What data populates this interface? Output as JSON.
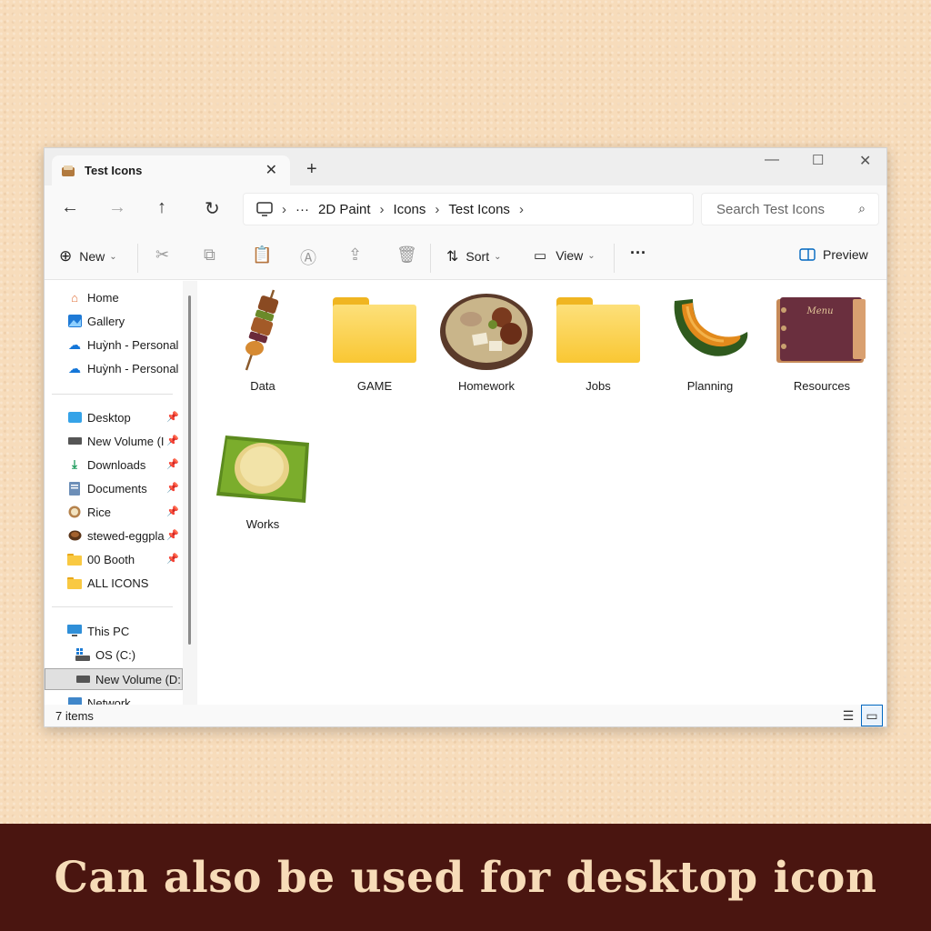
{
  "window": {
    "tab_title": "Test Icons"
  },
  "breadcrumb": [
    "2D Paint",
    "Icons",
    "Test Icons"
  ],
  "search": {
    "placeholder": "Search Test Icons"
  },
  "toolbar": {
    "new_label": "New",
    "sort_label": "Sort",
    "view_label": "View",
    "preview_label": "Preview"
  },
  "sidebar": {
    "quick": [
      {
        "label": "Home"
      },
      {
        "label": "Gallery"
      },
      {
        "label": "Huỳnh - Personal"
      },
      {
        "label": "Huỳnh - Personal"
      }
    ],
    "pinned": [
      {
        "label": "Desktop"
      },
      {
        "label": "New Volume (I"
      },
      {
        "label": "Downloads"
      },
      {
        "label": "Documents"
      },
      {
        "label": "Rice"
      },
      {
        "label": "stewed-eggpla"
      },
      {
        "label": "00 Booth"
      },
      {
        "label": "ALL ICONS"
      }
    ],
    "pc": [
      {
        "label": "This PC"
      },
      {
        "label": "OS (C:)"
      },
      {
        "label": "New Volume (D:"
      },
      {
        "label": "Network"
      }
    ]
  },
  "files": [
    {
      "name": "Data",
      "icon": "skewer-icon"
    },
    {
      "name": "GAME",
      "icon": "folder-icon"
    },
    {
      "name": "Homework",
      "icon": "soup-bowl-icon"
    },
    {
      "name": "Jobs",
      "icon": "folder-icon"
    },
    {
      "name": "Planning",
      "icon": "pumpkin-icon"
    },
    {
      "name": "Resources",
      "icon": "menu-book-icon"
    },
    {
      "name": "Works",
      "icon": "sticky-rice-icon"
    }
  ],
  "menu_book_text": "Menu",
  "status": {
    "count": "7 items"
  },
  "banner": {
    "text": "Can also be used for desktop icon"
  }
}
